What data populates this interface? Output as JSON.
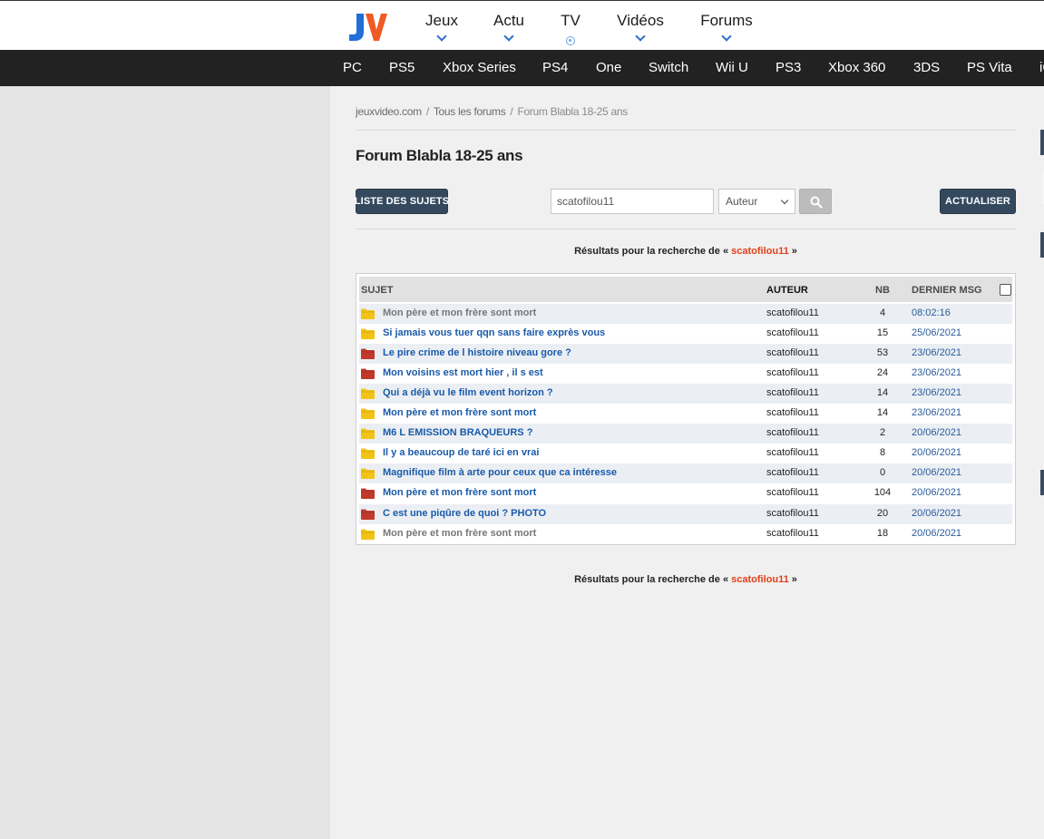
{
  "header": {
    "logo_text": "JV",
    "nav": [
      {
        "label": "Jeux",
        "indicator": "chevron-down-icon"
      },
      {
        "label": "Actu",
        "indicator": "chevron-down-icon"
      },
      {
        "label": "TV",
        "indicator": "live-dot-icon"
      },
      {
        "label": "Vidéos",
        "indicator": "chevron-down-icon"
      },
      {
        "label": "Forums",
        "indicator": "chevron-down-icon"
      }
    ]
  },
  "platforms": [
    "PC",
    "PS5",
    "Xbox Series",
    "PS4",
    "One",
    "Switch",
    "Wii U",
    "PS3",
    "Xbox 360",
    "3DS",
    "PS Vita",
    "iO"
  ],
  "breadcrumb": [
    "jeuxvideo.com",
    "Tous les forums",
    "Forum Blabla 18-25 ans"
  ],
  "page_title": "Forum Blabla 18-25 ans",
  "toolbar": {
    "list_button": "LISTE DES SUJETS",
    "search_value": "scatofilou11",
    "search_type": "Auteur",
    "refresh_button": "ACTUALISER"
  },
  "results": {
    "prefix": "Résultats pour la recherche de «",
    "term": "scatofilou11",
    "suffix": "»"
  },
  "table": {
    "headers": {
      "subject": "SUJET",
      "author": "AUTEUR",
      "nb": "NB",
      "last": "DERNIER MSG"
    },
    "rows": [
      {
        "subject": "Mon père et mon frère sont mort",
        "author": "scatofilou11",
        "nb": "4",
        "last": "08:02:16",
        "folder": "yellow",
        "read": true
      },
      {
        "subject": "Si jamais vous tuer qqn sans faire exprès vous",
        "author": "scatofilou11",
        "nb": "15",
        "last": "25/06/2021",
        "folder": "yellow",
        "read": false
      },
      {
        "subject": "Le pire crime de l histoire niveau gore ?",
        "author": "scatofilou11",
        "nb": "53",
        "last": "23/06/2021",
        "folder": "red",
        "read": false
      },
      {
        "subject": "Mon voisins est mort hier , il s est",
        "author": "scatofilou11",
        "nb": "24",
        "last": "23/06/2021",
        "folder": "red",
        "read": false
      },
      {
        "subject": "Qui a déjà vu le film event horizon ?",
        "author": "scatofilou11",
        "nb": "14",
        "last": "23/06/2021",
        "folder": "yellow",
        "read": false
      },
      {
        "subject": "Mon père et mon frère sont mort",
        "author": "scatofilou11",
        "nb": "14",
        "last": "23/06/2021",
        "folder": "yellow",
        "read": false
      },
      {
        "subject": "M6 L EMISSION BRAQUEURS ?",
        "author": "scatofilou11",
        "nb": "2",
        "last": "20/06/2021",
        "folder": "yellow",
        "read": false
      },
      {
        "subject": "Il y a beaucoup de taré ici en vrai",
        "author": "scatofilou11",
        "nb": "8",
        "last": "20/06/2021",
        "folder": "yellow",
        "read": false
      },
      {
        "subject": "Magnifique film à arte pour ceux que ca intéresse",
        "author": "scatofilou11",
        "nb": "0",
        "last": "20/06/2021",
        "folder": "yellow",
        "read": false
      },
      {
        "subject": "Mon père et mon frère sont mort",
        "author": "scatofilou11",
        "nb": "104",
        "last": "20/06/2021",
        "folder": "red",
        "read": false
      },
      {
        "subject": "C est une piqûre de quoi ? PHOTO",
        "author": "scatofilou11",
        "nb": "20",
        "last": "20/06/2021",
        "folder": "red",
        "read": false
      },
      {
        "subject": "Mon père et mon frère sont mort",
        "author": "scatofilou11",
        "nb": "18",
        "last": "20/06/2021",
        "folder": "yellow",
        "read": true
      }
    ]
  },
  "colors": {
    "folder_yellow": "#f2c314",
    "folder_red": "#c0392b",
    "link_blue": "#1a5aa8",
    "search_term": "#e0401a",
    "dark_button": "#34495e"
  }
}
